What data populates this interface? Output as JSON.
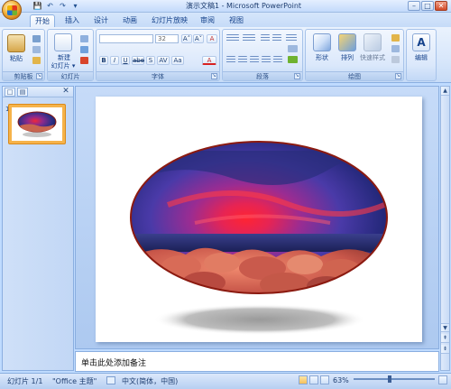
{
  "titlebar": {
    "title": "演示文稿1 - Microsoft PowerPoint",
    "qa_save": "💾",
    "qa_undo": "↶",
    "qa_redo": "↷",
    "qa_more": "▾",
    "min": "–",
    "max": "□",
    "close": "✕"
  },
  "tabs": [
    "开始",
    "插入",
    "设计",
    "动画",
    "幻灯片放映",
    "审阅",
    "视图"
  ],
  "groups": {
    "clipboard": {
      "label": "剪贴板",
      "paste": "粘贴"
    },
    "slides": {
      "label": "幻灯片",
      "new_slide": "新建",
      "new_slide2": "幻灯片 ▾"
    },
    "font": {
      "label": "字体",
      "font_size": "32",
      "grow": "A˄",
      "shrink": "A˅",
      "clear": "A",
      "bold": "B",
      "italic": "I",
      "underline": "U",
      "strike": "abe",
      "shadow": "S",
      "spacing": "AV",
      "case": "Aa",
      "color": "A"
    },
    "paragraph": {
      "label": "段落"
    },
    "drawing": {
      "label": "绘图",
      "shapes": "形状",
      "arrange": "排列",
      "quick_styles": "快速样式"
    },
    "editing": {
      "label": "编辑",
      "icon": "A"
    }
  },
  "panel": {
    "tab_outline": "□",
    "tab_slides": "▤",
    "close": "✕",
    "thumb_number": "1"
  },
  "notes": {
    "placeholder": "单击此处添加备注"
  },
  "status": {
    "slide_info": "幻灯片 1/1",
    "theme": "\"Office 主题\"",
    "language": "中文(简体，中国)",
    "zoom": "63%"
  },
  "scroll": {
    "up": "▲",
    "down": "▼",
    "prev": "⇞",
    "next": "⇟"
  },
  "colors": {
    "ellipse_border": "#8b1a10",
    "accent": "#15428b"
  }
}
